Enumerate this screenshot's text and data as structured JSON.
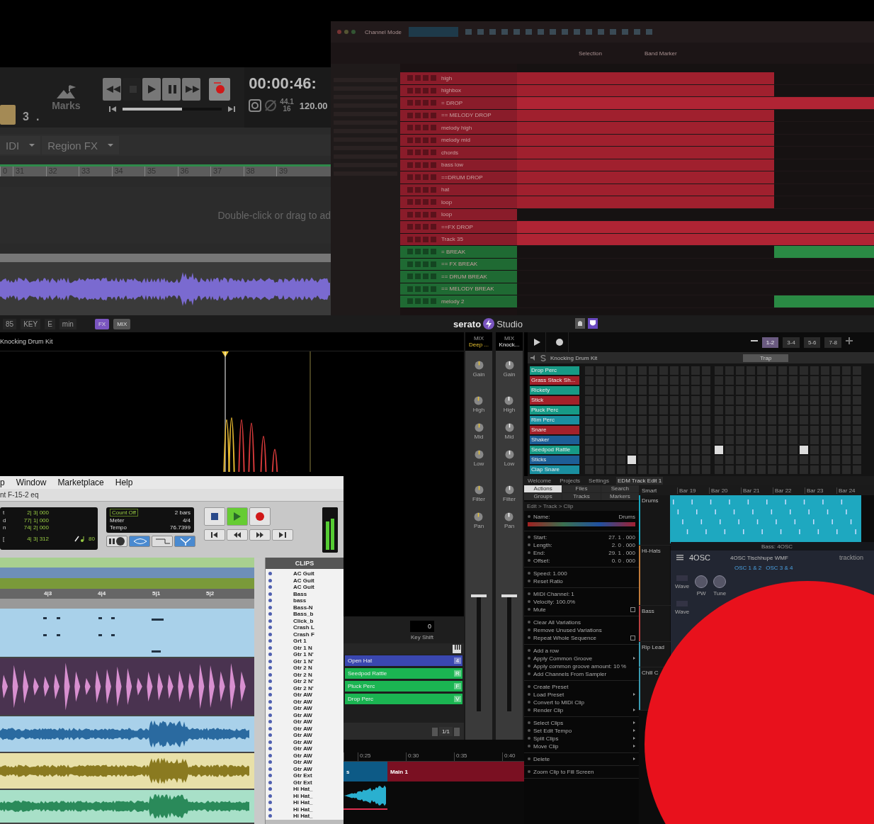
{
  "logic": {
    "position": {
      "level": 0.6
    },
    "bar_value": "3",
    "dot": ".",
    "marks_label": "Marks",
    "time": "00:00:46:",
    "sample_rate": "44.1",
    "bit_depth": "16",
    "tempo": "120.00",
    "menus": [
      "IDI",
      "Region FX"
    ],
    "ruler": [
      "0",
      "31",
      "32",
      "33",
      "34",
      "35",
      "36",
      "37",
      "38",
      "39"
    ],
    "hint": "Double-click or drag to ad"
  },
  "studio_one": {
    "toolbar": [
      "Channel Mode",
      "Selection",
      "Band Marker"
    ],
    "tracks": [
      {
        "name": "high",
        "color": "#8a1c2a",
        "kind": "part"
      },
      {
        "name": "highbox",
        "color": "#8a1c2a",
        "kind": "part"
      },
      {
        "name": "= DROP",
        "color": "#8a1c2a",
        "kind": "full"
      },
      {
        "name": "== MELODY DROP",
        "color": "#8a1c2a",
        "kind": "part"
      },
      {
        "name": "melody high",
        "color": "#8a1c2a",
        "kind": "part"
      },
      {
        "name": "melody mid",
        "color": "#8a1c2a",
        "kind": "part"
      },
      {
        "name": "chords",
        "color": "#8a1c2a",
        "kind": "part"
      },
      {
        "name": "bass low",
        "color": "#8a1c2a",
        "kind": "part"
      },
      {
        "name": "==DRUM DROP",
        "color": "#8a1c2a",
        "kind": "part"
      },
      {
        "name": "hat",
        "color": "#8a1c2a",
        "kind": "part"
      },
      {
        "name": "loop",
        "color": "#8a1c2a",
        "kind": "part"
      },
      {
        "name": "loop",
        "color": "#8a1c2a",
        "kind": "none"
      },
      {
        "name": "==FX DROP",
        "color": "#8a1c2a",
        "kind": "full"
      },
      {
        "name": "Track 35",
        "color": "#8a1c2a",
        "kind": "full"
      },
      {
        "name": "= BREAK",
        "color": "#1f6a33",
        "kind": "end"
      },
      {
        "name": "== FX BREAK",
        "color": "#1f6a33",
        "kind": "none"
      },
      {
        "name": "== DRUM BREAK",
        "color": "#1f6a33",
        "kind": "none"
      },
      {
        "name": "== MELODY BREAK",
        "color": "#1f6a33",
        "kind": "none"
      },
      {
        "name": "melody 2",
        "color": "#1f6a33",
        "kind": "end"
      }
    ]
  },
  "serato": {
    "bpm": "85",
    "key_label": "KEY",
    "key": "E",
    "mode": "min",
    "fx": "FX",
    "mix": "MIX",
    "logo": "serato",
    "product": "Studio",
    "deck_title": "Knocking Drum Kit",
    "mixer": [
      {
        "label": "MIX",
        "name": "Deep ...",
        "knobs": [
          "Gain",
          "High",
          "Mid",
          "Low",
          "Filter",
          "Pan"
        ]
      },
      {
        "label": "MIX",
        "name": "Knock...",
        "knobs": [
          "Gain",
          "High",
          "Mid",
          "Low",
          "Filter",
          "Pan"
        ]
      }
    ],
    "key_shift": {
      "value": "0",
      "label": "Key Shift"
    },
    "pads": [
      {
        "name": "Open Hat",
        "key": "4",
        "color": "#3a47b0"
      },
      {
        "name": "Seedpod Rattle",
        "key": "R",
        "color": "#1bb552"
      },
      {
        "name": "Pluck Perc",
        "key": "F",
        "color": "#1bb552"
      },
      {
        "name": "Drop Perc",
        "key": "V",
        "color": "#1bb552"
      }
    ],
    "page": "1/1",
    "timeline": {
      "ticks": [
        "0:25",
        "0:30",
        "0:35",
        "0:40"
      ],
      "clips": [
        {
          "name": "s",
          "color": "#0d5a86"
        },
        {
          "name": "Main 1",
          "color": "#7a1022"
        }
      ]
    },
    "sequencer": {
      "patterns": [
        {
          "label": "1-2",
          "selected": true
        },
        {
          "label": "3-4",
          "selected": false
        },
        {
          "label": "5-6",
          "selected": false
        },
        {
          "label": "7-8",
          "selected": false
        }
      ],
      "kit": "Knocking Drum Kit",
      "genre": "Trap",
      "rows": [
        {
          "name": "Drop Perc",
          "color": "#179a86",
          "steps": [
            false,
            false,
            false,
            false,
            false,
            false,
            false,
            false,
            false,
            false,
            false,
            false,
            false,
            false,
            false,
            false,
            false,
            false,
            false,
            false,
            false,
            false,
            false,
            false,
            false,
            false
          ]
        },
        {
          "name": "Grass Stack Sh...",
          "color": "#a3212a",
          "steps": [
            false,
            false,
            false,
            false,
            false,
            false,
            false,
            false,
            false,
            false,
            false,
            false,
            false,
            false,
            false,
            false,
            false,
            false,
            false,
            false,
            false,
            false,
            false,
            false,
            false,
            false
          ]
        },
        {
          "name": "Rickety",
          "color": "#179a86",
          "steps": [
            false,
            false,
            false,
            false,
            false,
            false,
            false,
            false,
            false,
            false,
            false,
            false,
            false,
            false,
            false,
            false,
            false,
            false,
            false,
            false,
            false,
            false,
            false,
            false,
            false,
            false
          ]
        },
        {
          "name": "Stick",
          "color": "#a3212a",
          "steps": [
            false,
            false,
            false,
            false,
            false,
            false,
            false,
            false,
            false,
            false,
            false,
            false,
            false,
            false,
            false,
            false,
            false,
            false,
            false,
            false,
            false,
            false,
            false,
            false,
            false,
            false
          ]
        },
        {
          "name": "Pluck Perc",
          "color": "#179a86",
          "steps": [
            false,
            false,
            false,
            false,
            false,
            false,
            false,
            false,
            false,
            false,
            false,
            false,
            false,
            false,
            false,
            false,
            false,
            false,
            false,
            false,
            false,
            false,
            false,
            false,
            false,
            false
          ]
        },
        {
          "name": "Rim Perc",
          "color": "#1a8fa0",
          "steps": [
            false,
            false,
            false,
            false,
            false,
            false,
            false,
            false,
            false,
            false,
            false,
            false,
            false,
            false,
            false,
            false,
            false,
            false,
            false,
            false,
            false,
            false,
            false,
            false,
            false,
            false
          ]
        },
        {
          "name": "Snare",
          "color": "#a3212a",
          "steps": [
            false,
            false,
            false,
            false,
            false,
            false,
            false,
            false,
            false,
            false,
            false,
            false,
            false,
            false,
            false,
            false,
            false,
            false,
            false,
            false,
            false,
            false,
            false,
            false,
            false,
            false
          ]
        },
        {
          "name": "Shaker",
          "color": "#1d5e96",
          "steps": [
            false,
            false,
            false,
            false,
            false,
            false,
            false,
            false,
            false,
            false,
            false,
            false,
            false,
            false,
            false,
            false,
            false,
            false,
            false,
            false,
            false,
            false,
            false,
            false,
            false,
            false
          ]
        },
        {
          "name": "Seedpod Rattle",
          "color": "#179a86",
          "steps": [
            false,
            false,
            false,
            false,
            false,
            false,
            false,
            false,
            false,
            false,
            false,
            false,
            true,
            false,
            false,
            false,
            false,
            false,
            false,
            false,
            true,
            false,
            false,
            false,
            false,
            false
          ]
        },
        {
          "name": "Sticks",
          "color": "#1d5e96",
          "steps": [
            false,
            false,
            false,
            false,
            true,
            false,
            false,
            false,
            false,
            false,
            false,
            false,
            false,
            false,
            false,
            false,
            false,
            false,
            false,
            false,
            false,
            false,
            false,
            false,
            false,
            false
          ]
        },
        {
          "name": "Clap Snare",
          "color": "#1a8fa0",
          "steps": [
            false,
            false,
            false,
            false,
            false,
            false,
            false,
            false,
            false,
            false,
            false,
            false,
            false,
            false,
            false,
            false,
            false,
            false,
            false,
            false,
            false,
            false,
            false,
            false,
            false,
            false
          ]
        }
      ]
    }
  },
  "tracktion": {
    "tabs": [
      {
        "label": "Welcome",
        "selected": false
      },
      {
        "label": "Projects",
        "selected": false
      },
      {
        "label": "Settings",
        "selected": false
      },
      {
        "label": "EDM Track Edit 1",
        "selected": true
      }
    ],
    "panel_tabs": [
      {
        "label": "Actions",
        "selected": true
      },
      {
        "label": "Files",
        "selected": false
      },
      {
        "label": "Search",
        "selected": false
      },
      {
        "label": "Groups",
        "selected": false
      },
      {
        "label": "Tracks",
        "selected": false
      },
      {
        "label": "Markers",
        "selected": false
      }
    ],
    "breadcrumb": "Edit > Track > Clip",
    "sections": [
      [
        {
          "label": "Name:",
          "value": "Drums",
          "kind": "value"
        }
      ],
      [
        {
          "label": "Start:",
          "value": "27. 1 . 000",
          "kind": "value"
        },
        {
          "label": "Length:",
          "value": "2. 0 . 000",
          "kind": "value"
        },
        {
          "label": "End:",
          "value": "29. 1 . 000",
          "kind": "value"
        },
        {
          "label": "Offset:",
          "value": "0. 0 . 000",
          "kind": "value"
        }
      ],
      [
        {
          "label": "Speed: 1.000",
          "kind": "action"
        },
        {
          "label": "Reset Ratio",
          "kind": "action"
        }
      ],
      [
        {
          "label": "MIDI Channel: 1",
          "kind": "action"
        },
        {
          "label": "Velocity: 100.0%",
          "kind": "action"
        },
        {
          "label": "Mute",
          "kind": "check",
          "checked": false
        }
      ],
      [
        {
          "label": "Clear All Variations",
          "kind": "action"
        },
        {
          "label": "Remove Unused Variations",
          "kind": "action"
        },
        {
          "label": "Repeat Whole Sequence",
          "kind": "check",
          "checked": false
        }
      ],
      [
        {
          "label": "Add a row",
          "kind": "action"
        },
        {
          "label": "Apply Common Groove",
          "kind": "submenu"
        },
        {
          "label": "Apply common groove amount: 10 %",
          "kind": "action"
        },
        {
          "label": "Add Channels From Sampler",
          "kind": "action"
        }
      ],
      [
        {
          "label": "Create Preset",
          "kind": "action"
        },
        {
          "label": "Load Preset",
          "kind": "submenu"
        },
        {
          "label": "Convert to MIDI Clip",
          "kind": "action"
        },
        {
          "label": "Render Clip",
          "kind": "submenu"
        }
      ],
      [
        {
          "label": "Select Clips",
          "kind": "submenu"
        },
        {
          "label": "Set Edit Tempo",
          "kind": "submenu"
        },
        {
          "label": "Split Clips",
          "kind": "submenu"
        },
        {
          "label": "Move Clip",
          "kind": "submenu"
        }
      ],
      [
        {
          "label": "Delete",
          "kind": "submenu"
        }
      ],
      [
        {
          "label": "Zoom Clip to Fill Screen",
          "kind": "action"
        }
      ]
    ],
    "snap": "Smart",
    "bars": [
      "Bar 19",
      "Bar 20",
      "Bar 21",
      "Bar 22",
      "Bar 23",
      "Bar 24"
    ],
    "tracks": [
      {
        "name": "Drums",
        "color": "#1aa8c0"
      },
      {
        "name": "Hi-Hats",
        "color": "#c07a3a"
      },
      {
        "name": "Bass",
        "color": "#b84040"
      },
      {
        "name": "Rip Lead",
        "color": "#3a9ab0"
      },
      {
        "name": "Chill C",
        "color": "#3a9ab0"
      }
    ],
    "plugin": {
      "title": "Bass: 4OSC",
      "name": "4OSC",
      "preset": "4OSC Tischhupe WMF",
      "brand": "tracktion",
      "tabs": [
        "OSC 1 & 2",
        "OSC 3 & 4"
      ],
      "knobs": [
        "Wave",
        "PW",
        "Tune"
      ],
      "knob_row2": [
        "Wave"
      ]
    }
  },
  "protools": {
    "menus": [
      "p",
      "Window",
      "Marketplace",
      "Help"
    ],
    "title": "nt F-15-2 eq",
    "counters": [
      {
        "label": "t",
        "value": "2| 3| 000"
      },
      {
        "label": "d",
        "value": "77| 1| 000"
      },
      {
        "label": "n",
        "value": "74| 2| 000"
      }
    ],
    "nudge": {
      "label": "[",
      "value": "4| 3| 312",
      "grid": "80"
    },
    "count_off": "Count Off",
    "count_bars": "2 bars",
    "meter_label": "Meter",
    "meter": "4/4",
    "tempo_label": "Tempo",
    "tempo": "76.7399",
    "modes": [
      {
        "kind": "prerecord",
        "on": false
      },
      {
        "kind": "loop",
        "on": true
      },
      {
        "kind": "punch",
        "on": false
      },
      {
        "kind": "merge",
        "on": true
      }
    ],
    "play_on": true,
    "ruler": [
      "4|3",
      "4|4",
      "5|1",
      "5|2"
    ],
    "lanes": [
      {
        "kind": "midi",
        "color": "#a9d1ea"
      },
      {
        "kind": "hits",
        "color": "#4a3350"
      },
      {
        "kind": "audio",
        "color": "#a9d1ea"
      },
      {
        "kind": "audio",
        "color": "#e8e0a8"
      },
      {
        "kind": "audio",
        "color": "#a8e0c8"
      }
    ],
    "clips_title": "CLIPS",
    "clips": [
      "AC Guit",
      "AC Guit",
      "AC Guit",
      "Bass",
      "bass",
      "Bass-N",
      "Bass_b",
      "Click_b",
      "Crash L",
      "Crash F",
      "Grt 1",
      "Gtr 1 N",
      "Gtr 1 N'",
      "Gtr 1 N'",
      "Gtr 2 N",
      "Gtr 2 N",
      "Gtr 2 N'",
      "Gtr 2 N'",
      "Gtr AW",
      "Gtr AW",
      "Gtr AW",
      "Gtr AW",
      "Gtr AW",
      "Gtr AW",
      "Gtr AW",
      "Gtr AW",
      "Gtr AW",
      "Gtr AW",
      "Gtr AW",
      "Gtr AW",
      "Gtr Ext",
      "Gtr Ext",
      "Hi Hat_",
      "Hi Hat_",
      "Hi Hat_",
      "Hi Hat_",
      "Hi Hat_"
    ]
  }
}
